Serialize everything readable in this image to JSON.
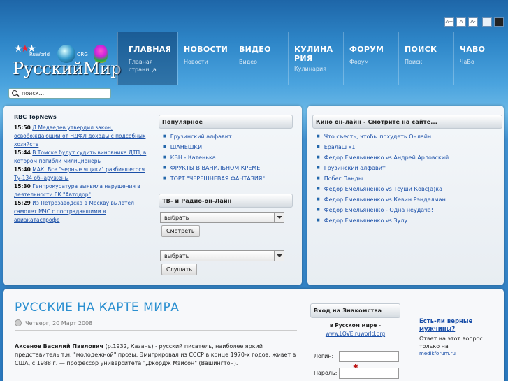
{
  "font_controls": [
    "A+",
    "A",
    "A-"
  ],
  "logo": {
    "text": "РусскийМир",
    "small_left": "RuWorld",
    "small_right": "ORG"
  },
  "nav": [
    {
      "title": "ГЛАВНАЯ",
      "sub": "Главная страница"
    },
    {
      "title": "НОВОСТИ",
      "sub": "Новости"
    },
    {
      "title": "ВИДЕО",
      "sub": "Видео"
    },
    {
      "title": "КУЛИНАРИЯ",
      "sub": "Кулинария"
    },
    {
      "title": "ФОРУМ",
      "sub": "Форум"
    },
    {
      "title": "ПОИСК",
      "sub": "Поиск"
    },
    {
      "title": "ЧАВО",
      "sub": "ЧаВо"
    }
  ],
  "search": {
    "value": "поиск..."
  },
  "rbc": {
    "title": "RBC TopNews",
    "items": [
      {
        "time": "15:50",
        "text": "Д.Медведев утвердил закон, освобождающий от НДФЛ доходы с подсобных хозяйств"
      },
      {
        "time": "15:44",
        "text": "В Томске будут судить виновника ДТП, в котором погибли милиционеры"
      },
      {
        "time": "15:40",
        "text": "МАК: Все \"черные ящики\" разбившегося Ту-134 обнаружены"
      },
      {
        "time": "15:30",
        "text": "Генпрокуратура выявила нарушения в деятельности ГК \"Автодор\""
      },
      {
        "time": "15:29",
        "text": "Из Петрозаводска в Москву вылетел самолет МЧС с пострадавшими в авиакатастрофе"
      }
    ]
  },
  "popular": {
    "title": "Популярное",
    "items": [
      "Грузинский алфавит",
      "ШАНЕШКИ",
      "КВН - Катенька",
      "ФРУКТЫ В ВАНИЛЬНОМ КРЕМЕ",
      "ТОРТ \"ЧЕРЕШНЕВАЯ ФАНТАЗИЯ\""
    ]
  },
  "tv": {
    "title": "ТВ- и Радио-он-Лайн",
    "select1": "выбрать",
    "button1": "Смотреть",
    "select2": "выбрать",
    "button2": "Слушать"
  },
  "kino": {
    "title": "Кино он-лайн - Смотрите на сайте...",
    "items": [
      "Что съесть, чтобы похудеть Онлайн",
      "Ералаш x1",
      "Федор Емельяненко vs Андрей Арловский",
      "Грузинский алфавит",
      "Побег Панды",
      "Федор Емельяненко vs Тсуши Ковс(а)ка",
      "Федор Емельяненко vs Кевин Рэнделман",
      "Федор Емельяненко - Одна неудача!",
      "Федор Емельяненко vs Зулу"
    ]
  },
  "article": {
    "title": "РУССКИЕ НА КАРТЕ МИРА",
    "date": "Четверг, 20 Март 2008",
    "author": "Аксенов Василий Павлович",
    "body": " (р.1932, Казань)  -  русский писатель, наиболее яркий представитель т.н. \"молодежной\" прозы. Эмигрировал из СССР в конце 1970-х годов, живет в США, с 1988 г. — профессор университета \"Джордж Мэйсон\" (Вашингтон)."
  },
  "login": {
    "title": "Вход на Знакомства",
    "sub": "в Русском мире -",
    "link": "www.LOVE.ruworld.org",
    "login_label": "Логин:",
    "password_label": "Пароль:"
  },
  "side_ad": {
    "headline": "Есть-ли верные мужчины?",
    "text": "Ответ на этот вопрос только на",
    "url": "medikforum.ru"
  }
}
